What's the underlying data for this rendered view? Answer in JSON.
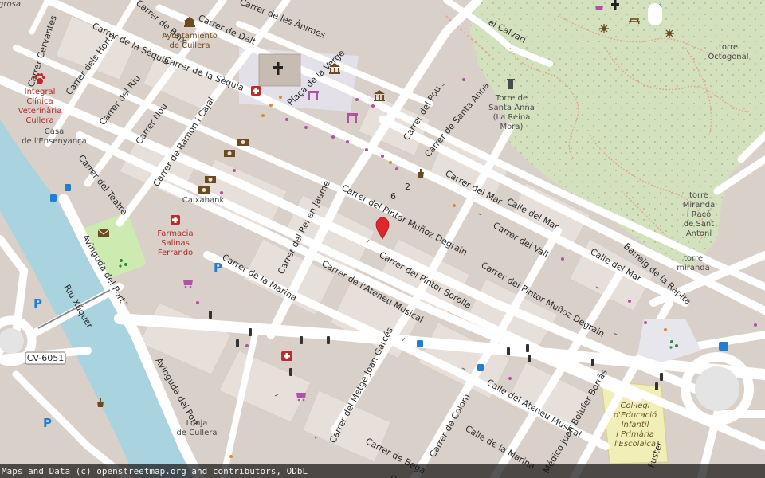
{
  "attribution": "Maps and Data (c) openstreetmap.org and contributors, ODbL",
  "colors": {
    "land": "#d9d0c9",
    "block": "#e9e3de",
    "road": "#ffffff",
    "river": "#a9d3df",
    "park": "#cdebb0",
    "hill": "#d6e3c3",
    "plaza": "#ececec",
    "marker": "#e0262b",
    "poi_magenta": "#b44fa8",
    "poi_brown": "#7a5a2a",
    "parking": "#1e7fd4"
  },
  "streets": [
    {
      "id": "cervantes",
      "text": "Carrer Cervantes"
    },
    {
      "id": "baix",
      "text": "Carrer de Baix"
    },
    {
      "id": "dalt",
      "text": "Carrer de Dalt"
    },
    {
      "id": "animes",
      "text": "Carrer de les Ànimes"
    },
    {
      "id": "sequia1",
      "text": "Carrer de la Sèquia"
    },
    {
      "id": "sequia2",
      "text": "Carrer de la Sèquia"
    },
    {
      "id": "horts",
      "text": "Carrer dels Horts"
    },
    {
      "id": "riu",
      "text": "Carrer del Riu"
    },
    {
      "id": "nou",
      "text": "Carrer Nou"
    },
    {
      "id": "cajal",
      "text": "Carrer de Ramon i Cajal"
    },
    {
      "id": "verge",
      "text": "Plaça de la Verge"
    },
    {
      "id": "pou",
      "text": "Carrer del Pou"
    },
    {
      "id": "santaanna",
      "text": "Carrer de Santa Anna"
    },
    {
      "id": "teatre",
      "text": "Carrer del Teatre"
    },
    {
      "id": "mar1",
      "text": "Carrer del Mar"
    },
    {
      "id": "mar2",
      "text": "Calle del Mar"
    },
    {
      "id": "mar3",
      "text": "Calle del Mar"
    },
    {
      "id": "pmd1",
      "text": "Carrer del Pintor Muñoz Degrain"
    },
    {
      "id": "pmd2",
      "text": "Carrer del Pintor Muñoz Degrain"
    },
    {
      "id": "vall",
      "text": "Carrer del Vall"
    },
    {
      "id": "rapita",
      "text": "Barreig de la Ràpita"
    },
    {
      "id": "reijaume",
      "text": "Carrer del Rei en Jaume"
    },
    {
      "id": "marina1",
      "text": "Carrer de la Marina"
    },
    {
      "id": "marina2",
      "text": "Calle de la Marina"
    },
    {
      "id": "sorolla",
      "text": "Carrer del Pintor Sorolla"
    },
    {
      "id": "ateneu1",
      "text": "Carrer de l'Ateneu Musical"
    },
    {
      "id": "ateneu2",
      "text": "Calle del Ateneu Musical"
    },
    {
      "id": "port1",
      "text": "Avinguda del Port"
    },
    {
      "id": "port2",
      "text": "Avinguda del Port"
    },
    {
      "id": "garces",
      "text": "Carrer del Metge Joan Garcés"
    },
    {
      "id": "bega",
      "text": "Carrer de Bega"
    },
    {
      "id": "colom",
      "text": "Carrer de Colom"
    },
    {
      "id": "borras",
      "text": "Médico Juan Bolufer Borràs"
    },
    {
      "id": "fuster",
      "text": "Fuster"
    },
    {
      "id": "quer",
      "text": "quer"
    },
    {
      "id": "calvari",
      "text": "el Calvari"
    },
    {
      "id": "riuxuquer",
      "text": "Riu Xúquer"
    }
  ],
  "places": [
    {
      "id": "ayuntamiento",
      "lines": [
        "Ayuntamiento",
        "de Cullera"
      ],
      "style": "brown"
    },
    {
      "id": "clinica",
      "lines": [
        "Integral",
        "Clínica",
        "Veterinària",
        "Cullera"
      ],
      "style": "red"
    },
    {
      "id": "casa",
      "lines": [
        "Casa",
        "de l'Ensenyança"
      ],
      "style": "dark"
    },
    {
      "id": "caixabank",
      "lines": [
        "Caixabank"
      ],
      "style": "dark"
    },
    {
      "id": "farmacia",
      "lines": [
        "Farmacia",
        "Salinas",
        "Ferrando"
      ],
      "style": "red"
    },
    {
      "id": "lonja",
      "lines": [
        "Lonja",
        "de Cullera"
      ],
      "style": "dark"
    },
    {
      "id": "torresanta",
      "lines": [
        "Torre de",
        "Santa Anna",
        "(La Reina",
        "Mora)"
      ],
      "style": "dark"
    },
    {
      "id": "torreoct",
      "lines": [
        "torre",
        "Octogonal"
      ],
      "style": "dark"
    },
    {
      "id": "torremiranda",
      "lines": [
        "torre",
        "Miranda",
        "i Racó",
        "de Sant",
        "Antoni"
      ],
      "style": "dark"
    },
    {
      "id": "torremir2",
      "lines": [
        "torre",
        "miranda"
      ],
      "style": "dark"
    },
    {
      "id": "colegi",
      "lines": [
        "Col·legi",
        "d'Educació",
        "Infantil",
        "i Primària",
        "l'Escolaica"
      ],
      "style": "school"
    },
    {
      "id": "grosa",
      "lines": [
        "grosa"
      ],
      "style": "dark"
    }
  ],
  "road_refs": {
    "cv6051": "CV-6051"
  },
  "house_numbers": [
    {
      "id": "n6",
      "text": "6"
    },
    {
      "id": "n2",
      "text": "2"
    }
  ],
  "icons": [
    "church-icon",
    "town-hall-icon",
    "museum-icon",
    "bank-icon",
    "pharmacy-icon",
    "veterinary-icon",
    "parking-icon",
    "shop-icon",
    "post-office-icon",
    "bus-stop-icon",
    "playground-icon",
    "fountain-icon",
    "marker-icon",
    "tower-icon",
    "viewpoint-icon",
    "picnic-icon"
  ]
}
